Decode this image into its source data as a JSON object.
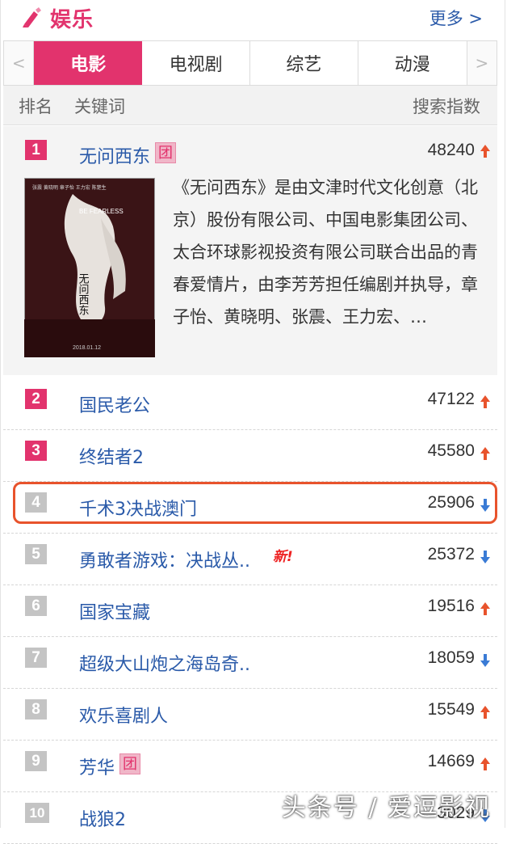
{
  "header": {
    "title": "娱乐",
    "more": "更多 >"
  },
  "tabs": {
    "prev": "<",
    "next": ">",
    "items": [
      "电影",
      "电视剧",
      "综艺",
      "动漫"
    ]
  },
  "columns": {
    "rank": "排名",
    "keyword": "关键词",
    "index": "搜索指数"
  },
  "featured": {
    "poster_caption": "BE FEARLESS",
    "poster_title": "无问西东",
    "poster_date": "2018.01.12",
    "description": "《无问西东》是由文津时代文化创意（北京）股份有限公司、中国电影集团公司、太合环球影视投资有限公司联合出品的青春爱情片，由李芳芳担任编剧并执导，章子怡、黄晓明、张震、王力宏、…"
  },
  "rankings": [
    {
      "rank": "1",
      "name": "无问西东",
      "badge": "团",
      "score": "48240",
      "trend": "up"
    },
    {
      "rank": "2",
      "name": "国民老公",
      "score": "47122",
      "trend": "up"
    },
    {
      "rank": "3",
      "name": "终结者2",
      "score": "45580",
      "trend": "up"
    },
    {
      "rank": "4",
      "name": "千术3决战澳门",
      "score": "25906",
      "trend": "down"
    },
    {
      "rank": "5",
      "name": "勇敢者游戏：决战丛..",
      "new_tag": "新!",
      "score": "25372",
      "trend": "down"
    },
    {
      "rank": "6",
      "name": "国家宝藏",
      "score": "19516",
      "trend": "up"
    },
    {
      "rank": "7",
      "name": "超级大山炮之海岛奇..",
      "score": "18059",
      "trend": "down"
    },
    {
      "rank": "8",
      "name": "欢乐喜剧人",
      "score": "15549",
      "trend": "up"
    },
    {
      "rank": "9",
      "name": "芳华",
      "badge": "团",
      "score": "14669",
      "trend": "up"
    },
    {
      "rank": "10",
      "name": "战狼2",
      "score": "3029",
      "trend": "down"
    }
  ],
  "colors": {
    "accent": "#e2336d",
    "link": "#2a5aa9",
    "up": "#e8532c",
    "down": "#3a7bd5",
    "highlight": "#e8532c"
  },
  "watermark": "头条号 / 爱逗影视"
}
